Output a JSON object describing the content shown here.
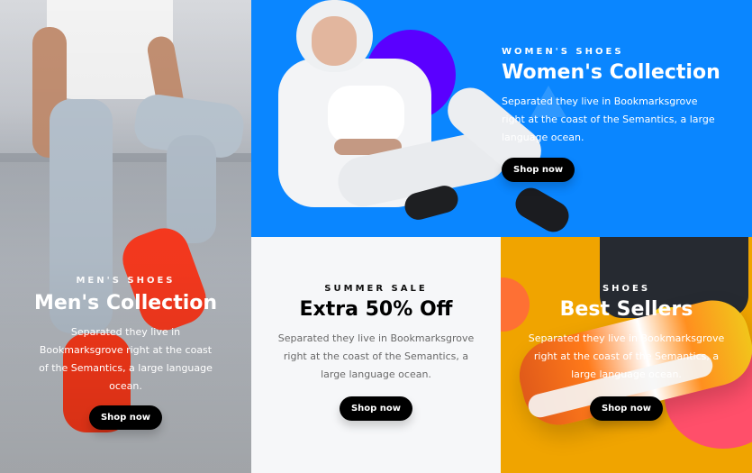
{
  "panels": {
    "men": {
      "eyebrow": "MEN'S SHOES",
      "title": "Men's Collection",
      "desc": "Separated they live in Bookmarksgrove right at the coast of the Semantics, a large language ocean.",
      "button": "Shop now"
    },
    "women": {
      "eyebrow": "WOMEN'S SHOES",
      "title": "Women's Collection",
      "desc": "Separated they live in Bookmarksgrove right at the coast of the Semantics, a large language ocean.",
      "button": "Shop now"
    },
    "sale": {
      "eyebrow": "SUMMER SALE",
      "title": "Extra 50% Off",
      "desc": "Separated they live in Bookmarksgrove right at the coast of the Semantics, a large language ocean.",
      "button": "Shop now"
    },
    "best": {
      "eyebrow": "SHOES",
      "title": "Best Sellers",
      "desc": "Separated they live in Bookmarksgrove right at the coast of the Semantics, a large language ocean.",
      "button": "Shop now"
    }
  },
  "colors": {
    "women_bg": "#0a86ff",
    "women_circle": "#5a00ff",
    "sale_bg": "#f6f7f9",
    "best_bg": "#f0a400",
    "best_blob": "#ff4f6a",
    "button_bg": "#000000"
  }
}
